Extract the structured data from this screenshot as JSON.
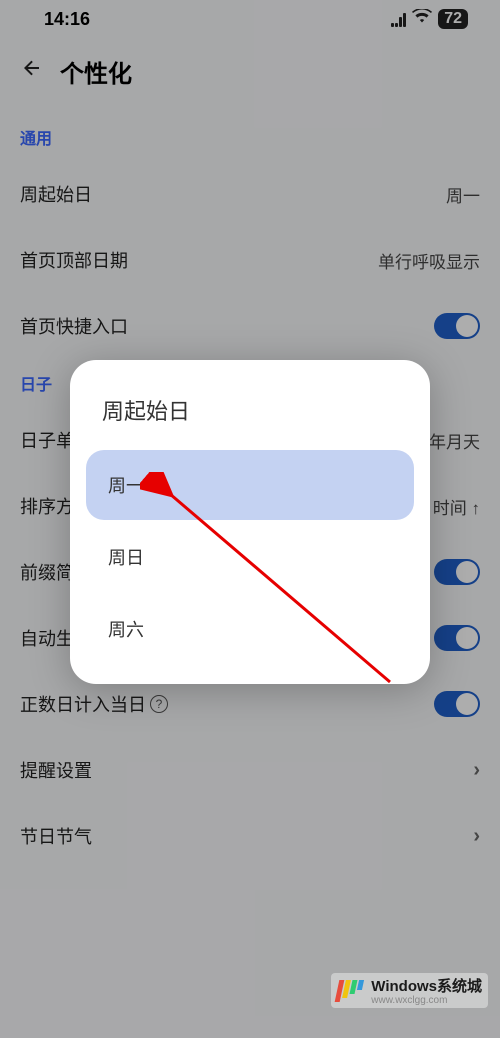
{
  "status": {
    "time": "14:16",
    "battery": "72"
  },
  "header": {
    "title": "个性化"
  },
  "sections": {
    "general": {
      "title": "通用"
    },
    "days": {
      "title": "日子"
    }
  },
  "rows": {
    "week_start": {
      "label": "周起始日",
      "value": "周一"
    },
    "top_date": {
      "label": "首页顶部日期",
      "value": "单行呼吸显示"
    },
    "quick_entry": {
      "label": "首页快捷入口"
    },
    "day_unit": {
      "label": "日子单",
      "value_suffix": "年月天"
    },
    "sort": {
      "label": "排序方",
      "value_suffix": "时间 ↑"
    },
    "prefix": {
      "label": "前缀简"
    },
    "auto_gen": {
      "label": "自动生"
    },
    "count_day": {
      "label": "正数日计入当日"
    },
    "remind": {
      "label": "提醒设置"
    },
    "festival": {
      "label": "节日节气"
    }
  },
  "dialog": {
    "title": "周起始日",
    "options": [
      "周一",
      "周日",
      "周六"
    ],
    "selected_index": 0
  },
  "watermark": {
    "line1": "Windows系统城",
    "line2": "www.wxclgg.com"
  }
}
